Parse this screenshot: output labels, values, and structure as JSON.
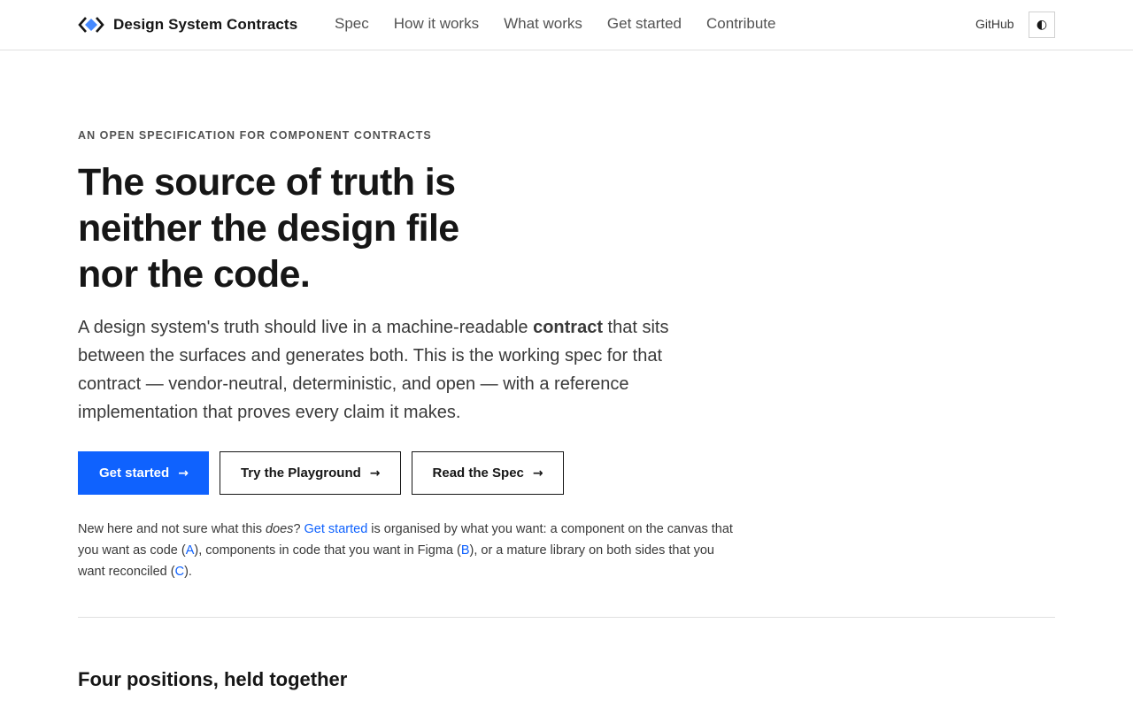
{
  "brand": {
    "name": "Design System Contracts",
    "logo_icon": "diamond-brackets-logo-icon",
    "colors": {
      "logo_blue": "#4589ff",
      "logo_dark": "#161616"
    }
  },
  "nav": {
    "items": [
      {
        "label": "Spec"
      },
      {
        "label": "How it works"
      },
      {
        "label": "What works"
      },
      {
        "label": "Get started"
      },
      {
        "label": "Contribute"
      }
    ],
    "github_label": "GitHub",
    "theme_toggle_glyph": "◐",
    "theme_toggle_icon": "half-circle-contrast-icon"
  },
  "hero": {
    "eyebrow": "AN OPEN SPECIFICATION FOR COMPONENT CONTRACTS",
    "headline_lines": [
      "The source of truth is",
      "neither the design file",
      "nor the code."
    ],
    "lead": {
      "before": "A design system's truth should live in a machine-readable ",
      "bold": "contract",
      "after": " that sits between the surfaces and generates both. This is the working spec for that contract — vendor-neutral, deterministic, and open — with a reference implementation that proves every claim it makes."
    },
    "ctas": [
      {
        "label": "Get started",
        "arrow": "→",
        "style": "primary"
      },
      {
        "label": "Try the Playground",
        "arrow": "→",
        "style": "secondary"
      },
      {
        "label": "Read the Spec",
        "arrow": "→",
        "style": "secondary"
      }
    ],
    "note": {
      "t1": "New here and not sure what this ",
      "em": "does",
      "t2": "? ",
      "link": "Get started",
      "t3": " is organised by what you want: a component on the canvas that you want as code (",
      "a": "A",
      "t4": "), components in code that you want in Figma (",
      "b": "B",
      "t5": "), or a mature library on both sides that you want reconciled (",
      "c": "C",
      "t6": ")."
    },
    "colors": {
      "primary": "#0f62fe",
      "text": "#161616",
      "muted": "#525252"
    }
  },
  "section": {
    "title": "Four positions, held together"
  }
}
